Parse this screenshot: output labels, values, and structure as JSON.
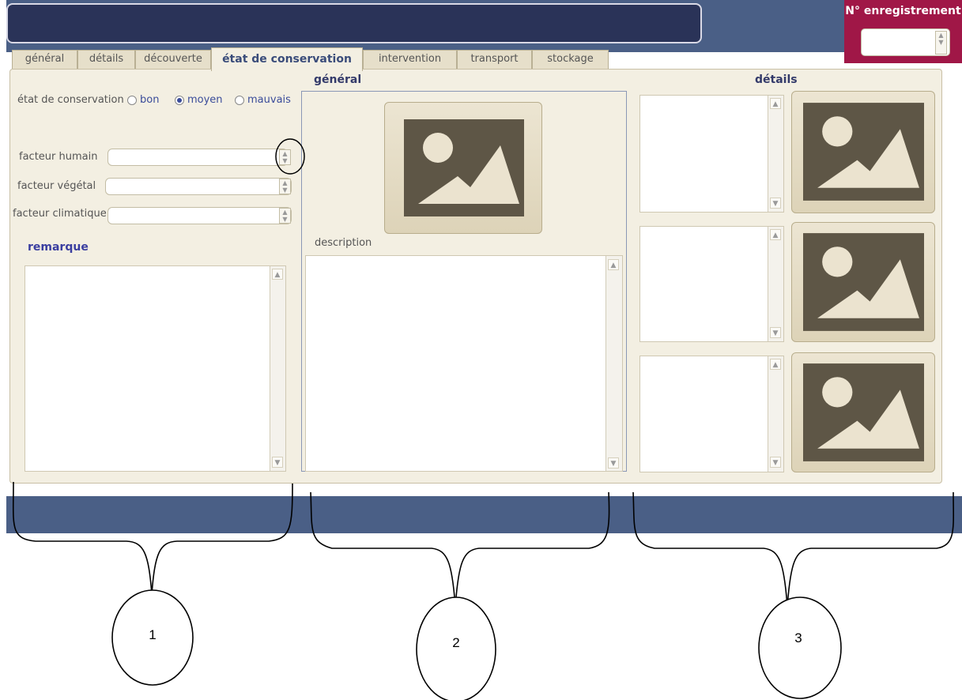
{
  "header": {
    "registration_label": "N° enregistrement",
    "registration_value": ""
  },
  "tabs": [
    {
      "label": "général",
      "active": false
    },
    {
      "label": "détails",
      "active": false
    },
    {
      "label": "découverte",
      "active": false
    },
    {
      "label": "état de conservation",
      "active": true
    },
    {
      "label": "intervention",
      "active": false
    },
    {
      "label": "transport",
      "active": false
    },
    {
      "label": "stockage",
      "active": false
    }
  ],
  "section1": {
    "condition_label": "état de conservation",
    "options": [
      "bon",
      "moyen",
      "mauvais"
    ],
    "selected": "moyen",
    "human_factor_label": "facteur humain",
    "plant_factor_label": "facteur végétal",
    "climate_factor_label": "facteur climatique",
    "remark_label": "remarque"
  },
  "section2": {
    "title": "général",
    "description_label": "description"
  },
  "section3": {
    "title": "détails"
  },
  "annotations": [
    "1",
    "2",
    "3"
  ],
  "colors": {
    "header_bar": "#4a5f86",
    "title_box": "#2a3358",
    "registration_bg": "#a01747",
    "panel_bg": "#f3efe2",
    "image_placeholder": "#5e5646"
  }
}
